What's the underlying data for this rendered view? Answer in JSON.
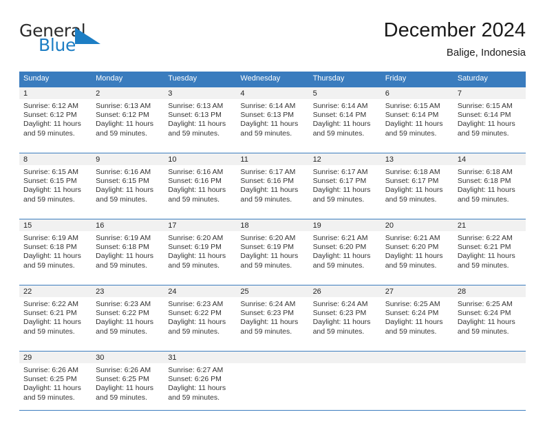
{
  "brand": {
    "name_part1": "General",
    "name_part2": "Blue",
    "logo_icon": "triangle-mark"
  },
  "header": {
    "month_title": "December 2024",
    "location": "Balige, Indonesia"
  },
  "colors": {
    "header_blue": "#3a7cbe",
    "brand_blue": "#1d7ec4",
    "daynum_band": "#f1f1f1",
    "text": "#333333"
  },
  "weekdays": [
    "Sunday",
    "Monday",
    "Tuesday",
    "Wednesday",
    "Thursday",
    "Friday",
    "Saturday"
  ],
  "weeks": [
    [
      {
        "day": "1",
        "sunrise": "Sunrise: 6:12 AM",
        "sunset": "Sunset: 6:12 PM",
        "daylight1": "Daylight: 11 hours",
        "daylight2": "and 59 minutes."
      },
      {
        "day": "2",
        "sunrise": "Sunrise: 6:13 AM",
        "sunset": "Sunset: 6:12 PM",
        "daylight1": "Daylight: 11 hours",
        "daylight2": "and 59 minutes."
      },
      {
        "day": "3",
        "sunrise": "Sunrise: 6:13 AM",
        "sunset": "Sunset: 6:13 PM",
        "daylight1": "Daylight: 11 hours",
        "daylight2": "and 59 minutes."
      },
      {
        "day": "4",
        "sunrise": "Sunrise: 6:14 AM",
        "sunset": "Sunset: 6:13 PM",
        "daylight1": "Daylight: 11 hours",
        "daylight2": "and 59 minutes."
      },
      {
        "day": "5",
        "sunrise": "Sunrise: 6:14 AM",
        "sunset": "Sunset: 6:14 PM",
        "daylight1": "Daylight: 11 hours",
        "daylight2": "and 59 minutes."
      },
      {
        "day": "6",
        "sunrise": "Sunrise: 6:15 AM",
        "sunset": "Sunset: 6:14 PM",
        "daylight1": "Daylight: 11 hours",
        "daylight2": "and 59 minutes."
      },
      {
        "day": "7",
        "sunrise": "Sunrise: 6:15 AM",
        "sunset": "Sunset: 6:14 PM",
        "daylight1": "Daylight: 11 hours",
        "daylight2": "and 59 minutes."
      }
    ],
    [
      {
        "day": "8",
        "sunrise": "Sunrise: 6:15 AM",
        "sunset": "Sunset: 6:15 PM",
        "daylight1": "Daylight: 11 hours",
        "daylight2": "and 59 minutes."
      },
      {
        "day": "9",
        "sunrise": "Sunrise: 6:16 AM",
        "sunset": "Sunset: 6:15 PM",
        "daylight1": "Daylight: 11 hours",
        "daylight2": "and 59 minutes."
      },
      {
        "day": "10",
        "sunrise": "Sunrise: 6:16 AM",
        "sunset": "Sunset: 6:16 PM",
        "daylight1": "Daylight: 11 hours",
        "daylight2": "and 59 minutes."
      },
      {
        "day": "11",
        "sunrise": "Sunrise: 6:17 AM",
        "sunset": "Sunset: 6:16 PM",
        "daylight1": "Daylight: 11 hours",
        "daylight2": "and 59 minutes."
      },
      {
        "day": "12",
        "sunrise": "Sunrise: 6:17 AM",
        "sunset": "Sunset: 6:17 PM",
        "daylight1": "Daylight: 11 hours",
        "daylight2": "and 59 minutes."
      },
      {
        "day": "13",
        "sunrise": "Sunrise: 6:18 AM",
        "sunset": "Sunset: 6:17 PM",
        "daylight1": "Daylight: 11 hours",
        "daylight2": "and 59 minutes."
      },
      {
        "day": "14",
        "sunrise": "Sunrise: 6:18 AM",
        "sunset": "Sunset: 6:18 PM",
        "daylight1": "Daylight: 11 hours",
        "daylight2": "and 59 minutes."
      }
    ],
    [
      {
        "day": "15",
        "sunrise": "Sunrise: 6:19 AM",
        "sunset": "Sunset: 6:18 PM",
        "daylight1": "Daylight: 11 hours",
        "daylight2": "and 59 minutes."
      },
      {
        "day": "16",
        "sunrise": "Sunrise: 6:19 AM",
        "sunset": "Sunset: 6:18 PM",
        "daylight1": "Daylight: 11 hours",
        "daylight2": "and 59 minutes."
      },
      {
        "day": "17",
        "sunrise": "Sunrise: 6:20 AM",
        "sunset": "Sunset: 6:19 PM",
        "daylight1": "Daylight: 11 hours",
        "daylight2": "and 59 minutes."
      },
      {
        "day": "18",
        "sunrise": "Sunrise: 6:20 AM",
        "sunset": "Sunset: 6:19 PM",
        "daylight1": "Daylight: 11 hours",
        "daylight2": "and 59 minutes."
      },
      {
        "day": "19",
        "sunrise": "Sunrise: 6:21 AM",
        "sunset": "Sunset: 6:20 PM",
        "daylight1": "Daylight: 11 hours",
        "daylight2": "and 59 minutes."
      },
      {
        "day": "20",
        "sunrise": "Sunrise: 6:21 AM",
        "sunset": "Sunset: 6:20 PM",
        "daylight1": "Daylight: 11 hours",
        "daylight2": "and 59 minutes."
      },
      {
        "day": "21",
        "sunrise": "Sunrise: 6:22 AM",
        "sunset": "Sunset: 6:21 PM",
        "daylight1": "Daylight: 11 hours",
        "daylight2": "and 59 minutes."
      }
    ],
    [
      {
        "day": "22",
        "sunrise": "Sunrise: 6:22 AM",
        "sunset": "Sunset: 6:21 PM",
        "daylight1": "Daylight: 11 hours",
        "daylight2": "and 59 minutes."
      },
      {
        "day": "23",
        "sunrise": "Sunrise: 6:23 AM",
        "sunset": "Sunset: 6:22 PM",
        "daylight1": "Daylight: 11 hours",
        "daylight2": "and 59 minutes."
      },
      {
        "day": "24",
        "sunrise": "Sunrise: 6:23 AM",
        "sunset": "Sunset: 6:22 PM",
        "daylight1": "Daylight: 11 hours",
        "daylight2": "and 59 minutes."
      },
      {
        "day": "25",
        "sunrise": "Sunrise: 6:24 AM",
        "sunset": "Sunset: 6:23 PM",
        "daylight1": "Daylight: 11 hours",
        "daylight2": "and 59 minutes."
      },
      {
        "day": "26",
        "sunrise": "Sunrise: 6:24 AM",
        "sunset": "Sunset: 6:23 PM",
        "daylight1": "Daylight: 11 hours",
        "daylight2": "and 59 minutes."
      },
      {
        "day": "27",
        "sunrise": "Sunrise: 6:25 AM",
        "sunset": "Sunset: 6:24 PM",
        "daylight1": "Daylight: 11 hours",
        "daylight2": "and 59 minutes."
      },
      {
        "day": "28",
        "sunrise": "Sunrise: 6:25 AM",
        "sunset": "Sunset: 6:24 PM",
        "daylight1": "Daylight: 11 hours",
        "daylight2": "and 59 minutes."
      }
    ],
    [
      {
        "day": "29",
        "sunrise": "Sunrise: 6:26 AM",
        "sunset": "Sunset: 6:25 PM",
        "daylight1": "Daylight: 11 hours",
        "daylight2": "and 59 minutes."
      },
      {
        "day": "30",
        "sunrise": "Sunrise: 6:26 AM",
        "sunset": "Sunset: 6:25 PM",
        "daylight1": "Daylight: 11 hours",
        "daylight2": "and 59 minutes."
      },
      {
        "day": "31",
        "sunrise": "Sunrise: 6:27 AM",
        "sunset": "Sunset: 6:26 PM",
        "daylight1": "Daylight: 11 hours",
        "daylight2": "and 59 minutes."
      },
      {
        "day": "",
        "sunrise": "",
        "sunset": "",
        "daylight1": "",
        "daylight2": ""
      },
      {
        "day": "",
        "sunrise": "",
        "sunset": "",
        "daylight1": "",
        "daylight2": ""
      },
      {
        "day": "",
        "sunrise": "",
        "sunset": "",
        "daylight1": "",
        "daylight2": ""
      },
      {
        "day": "",
        "sunrise": "",
        "sunset": "",
        "daylight1": "",
        "daylight2": ""
      }
    ]
  ]
}
